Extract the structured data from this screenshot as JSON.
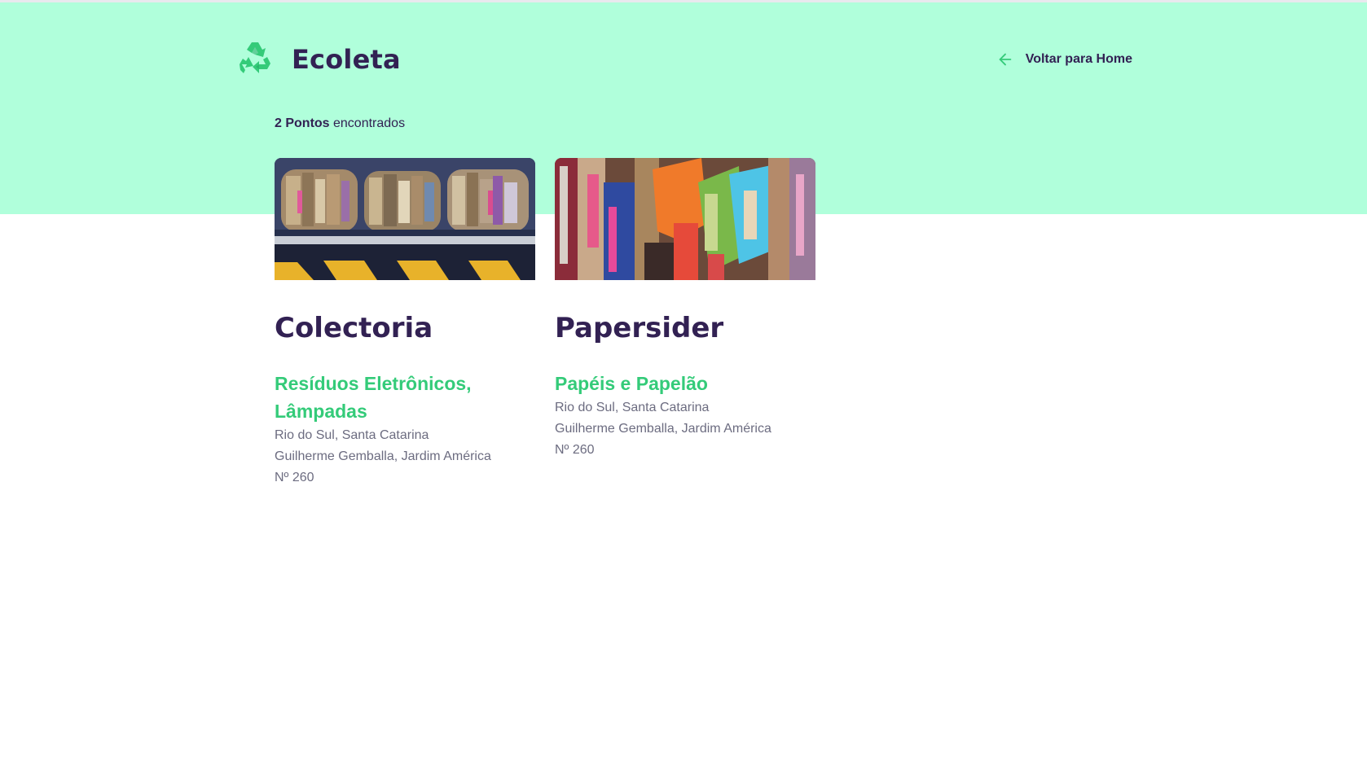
{
  "header": {
    "brand_name": "Ecoleta",
    "back_label": "Voltar para Home"
  },
  "results": {
    "count_bold": "2 Pontos",
    "count_rest": " encontrados"
  },
  "points": [
    {
      "name": "Colectoria",
      "items": "Resíduos Eletrônicos, Lâmpadas",
      "city": "Rio do Sul, Santa Catarina",
      "address": "Guilherme Gemballa, Jardim América",
      "number": "Nº 260",
      "image_icon": "cardboard-bales-photo"
    },
    {
      "name": "Papersider",
      "items": "Papéis e Papelão",
      "city": "Rio do Sul, Santa Catarina",
      "address": "Guilherme Gemballa, Jardim América",
      "number": "Nº 260",
      "image_icon": "paper-scraps-photo"
    }
  ],
  "colors": {
    "hero_bg": "#b0ffdb",
    "title": "#322153",
    "accent_green": "#34cb79",
    "text_gray": "#6c6c80"
  }
}
